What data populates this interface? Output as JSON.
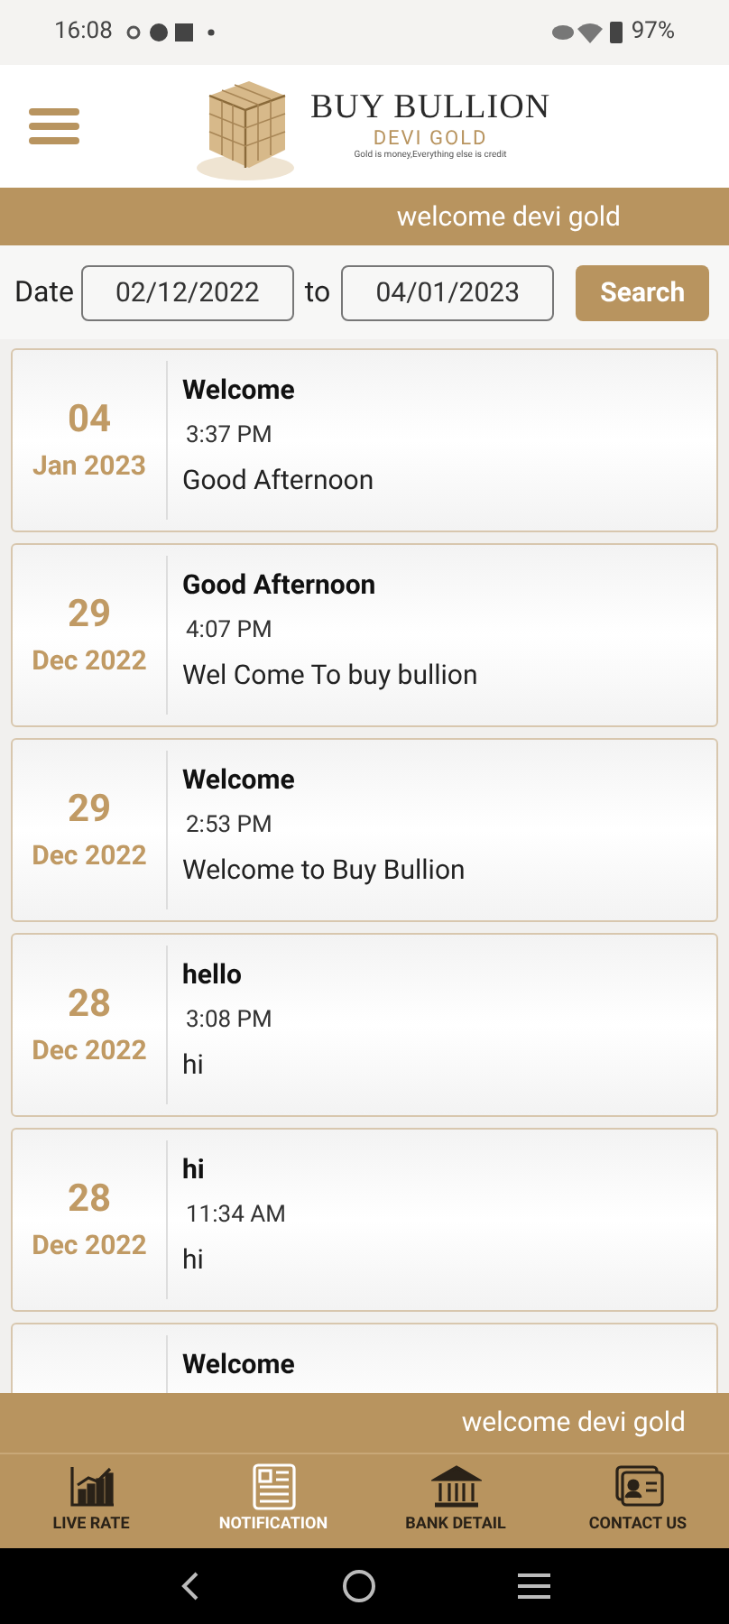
{
  "status_bar": {
    "time": "16:08",
    "battery": "97%"
  },
  "header": {
    "brand": "BUY BULLION",
    "sub_brand": "DEVI GOLD",
    "tagline": "Gold is money,Everything else is credit"
  },
  "marquee_top": "welcome devi gold",
  "filter": {
    "label": "Date",
    "from": "02/12/2022",
    "separator": "to",
    "to": "04/01/2023",
    "button": "Search"
  },
  "notifications": [
    {
      "day": "04",
      "month_year": "Jan 2023",
      "title": "Welcome",
      "time": "3:37 PM",
      "message": "Good Afternoon"
    },
    {
      "day": "29",
      "month_year": "Dec 2022",
      "title": "Good Afternoon",
      "time": "4:07 PM",
      "message": "Wel Come To buy bullion"
    },
    {
      "day": "29",
      "month_year": "Dec 2022",
      "title": "Welcome",
      "time": "2:53 PM",
      "message": "Welcome to Buy Bullion"
    },
    {
      "day": "28",
      "month_year": "Dec 2022",
      "title": "hello",
      "time": "3:08 PM",
      "message": "hi"
    },
    {
      "day": "28",
      "month_year": "Dec 2022",
      "title": "hi",
      "time": "11:34 AM",
      "message": "hi"
    },
    {
      "title": "Welcome"
    }
  ],
  "marquee_bottom": "welcome devi gold",
  "bottom_nav": [
    {
      "label": "LIVE RATE",
      "kind": "chart",
      "selected": false
    },
    {
      "label": "NOTIFICATION",
      "kind": "news",
      "selected": true
    },
    {
      "label": "BANK DETAIL",
      "kind": "bank",
      "selected": false
    },
    {
      "label": "CONTACT US",
      "kind": "contact",
      "selected": false
    }
  ]
}
